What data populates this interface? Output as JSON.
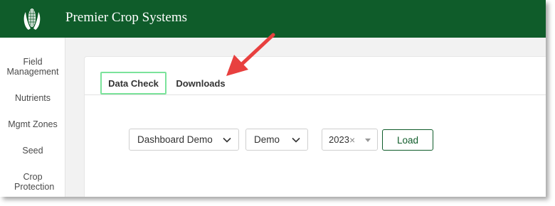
{
  "header": {
    "title": "Premier Crop Systems",
    "logo_icon": "corn-icon",
    "background": "#0f5c2a"
  },
  "sidebar": {
    "items": [
      {
        "label": "Field Management"
      },
      {
        "label": "Nutrients"
      },
      {
        "label": "Mgmt Zones"
      },
      {
        "label": "Seed"
      },
      {
        "label": "Crop Protection"
      }
    ]
  },
  "tabs": [
    {
      "label": "Data Check",
      "active": true
    },
    {
      "label": "Downloads",
      "active": false
    }
  ],
  "filters": {
    "dashboard": {
      "value": "Dashboard Demo"
    },
    "grower": {
      "value": "Demo"
    },
    "year": {
      "value": "2023",
      "clear_icon": "close-icon",
      "caret_icon": "caret-down-icon"
    }
  },
  "load_button": {
    "label": "Load"
  },
  "annotation": {
    "icon": "red-arrow-icon",
    "color": "#e8403f"
  },
  "colors": {
    "accent": "#0f5c2a",
    "active_tab_border": "#7be39b"
  }
}
